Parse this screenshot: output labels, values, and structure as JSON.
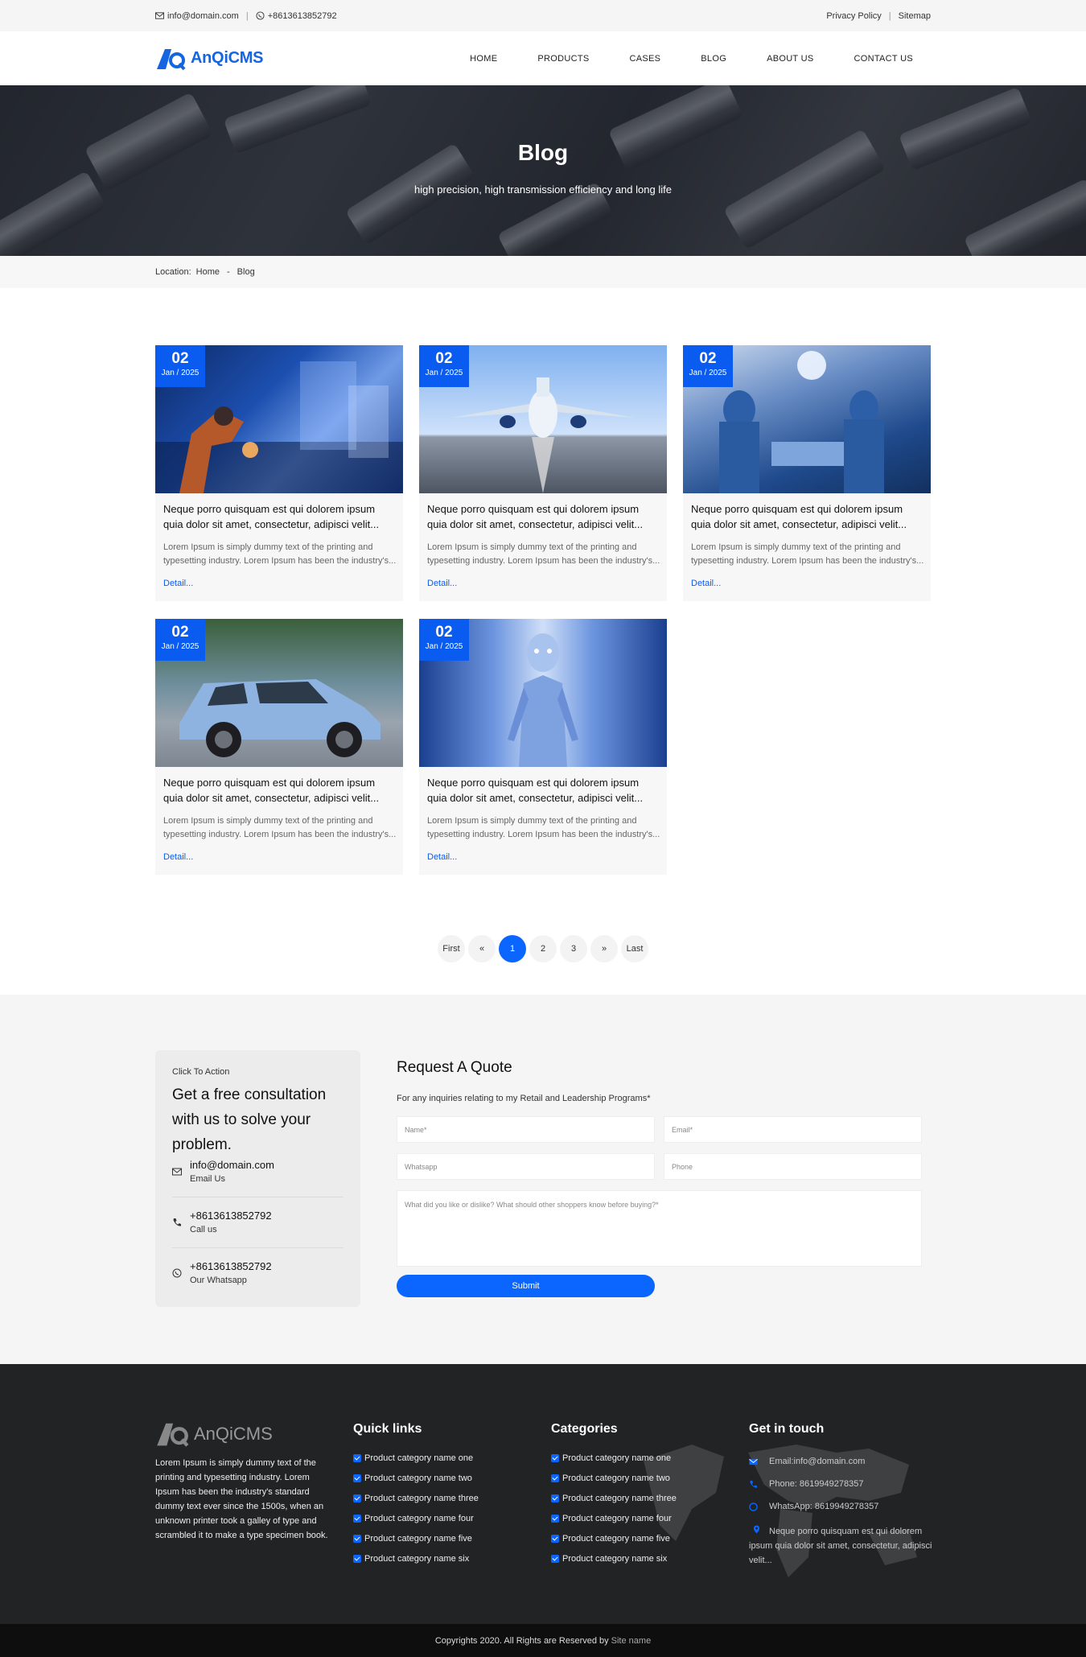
{
  "topbar": {
    "email": "info@domain.com",
    "whatsapp": "+8613613852792",
    "privacy": "Privacy Policy",
    "sitemap": "Sitemap"
  },
  "header": {
    "logo_text": "AnQiCMS",
    "nav": [
      "HOME",
      "PRODUCTS",
      "CASES",
      "BLOG",
      "ABOUT US",
      "CONTACT US"
    ]
  },
  "hero": {
    "title": "Blog",
    "subtitle": "high precision, high transmission efficiency and long life"
  },
  "breadcrumb": {
    "label": "Location:",
    "home": "Home",
    "sep": "-",
    "current": "Blog"
  },
  "posts": [
    {
      "day": "02",
      "month": "Jan / 2025",
      "image": "robot-arm-factory",
      "title": "Neque porro quisquam est qui dolorem ipsum quia dolor sit amet, consectetur, adipisci velit...",
      "excerpt": "Lorem Ipsum is simply dummy text of the printing and typesetting industry. Lorem Ipsum has been the industry's...",
      "more": "Detail..."
    },
    {
      "day": "02",
      "month": "Jan / 2025",
      "image": "airplane-runway",
      "title": "Neque porro quisquam est qui dolorem ipsum quia dolor sit amet, consectetur, adipisci velit...",
      "excerpt": "Lorem Ipsum is simply dummy text of the printing and typesetting industry. Lorem Ipsum has been the industry's...",
      "more": "Detail..."
    },
    {
      "day": "02",
      "month": "Jan / 2025",
      "image": "surgery-room",
      "title": "Neque porro quisquam est qui dolorem ipsum quia dolor sit amet, consectetur, adipisci velit...",
      "excerpt": "Lorem Ipsum is simply dummy text of the printing and typesetting industry. Lorem Ipsum has been the industry's...",
      "more": "Detail..."
    },
    {
      "day": "02",
      "month": "Jan / 2025",
      "image": "blue-suv",
      "title": "Neque porro quisquam est qui dolorem ipsum quia dolor sit amet, consectetur, adipisci velit...",
      "excerpt": "Lorem Ipsum is simply dummy text of the printing and typesetting industry. Lorem Ipsum has been the industry's...",
      "more": "Detail..."
    },
    {
      "day": "02",
      "month": "Jan / 2025",
      "image": "humanoid-robot",
      "title": "Neque porro quisquam est qui dolorem ipsum quia dolor sit amet, consectetur, adipisci velit...",
      "excerpt": "Lorem Ipsum is simply dummy text of the printing and typesetting industry. Lorem Ipsum has been the industry's...",
      "more": "Detail..."
    }
  ],
  "pagination": {
    "first": "First",
    "prev": "«",
    "pages": [
      "1",
      "2",
      "3"
    ],
    "active": "1",
    "next": "»",
    "last": "Last"
  },
  "cta": {
    "kicker": "Click To Action",
    "heading": "Get a free consultation with us to solve your problem.",
    "items": [
      {
        "icon": "mail-icon",
        "value": "info@domain.com",
        "label": "Email Us"
      },
      {
        "icon": "phone-icon",
        "value": "+8613613852792",
        "label": "Call us"
      },
      {
        "icon": "whatsapp-icon",
        "value": "+8613613852792",
        "label": "Our Whatsapp"
      }
    ]
  },
  "quote_form": {
    "title": "Request A Quote",
    "subtitle": "For any inquiries relating to my Retail and Leadership Programs*",
    "name_placeholder": "Name*",
    "email_placeholder": "Email*",
    "whatsapp_placeholder": "Whatsapp",
    "phone_placeholder": "Phone",
    "message_placeholder": "What did you like or dislike? What should other shoppers know before buying?*",
    "submit": "Submit"
  },
  "footer": {
    "logo_text": "AnQiCMS",
    "about": "Lorem Ipsum is simply dummy text of the printing and typesetting industry. Lorem Ipsum has been the industry's standard dummy text ever since the 1500s, when an unknown printer took a galley of type and scrambled it to make a type specimen book.",
    "quick_links": {
      "title": "Quick links",
      "items": [
        "Product category name one",
        "Product category name two",
        "Product category name three",
        "Product category name four",
        "Product category name five",
        "Product category name six"
      ]
    },
    "categories": {
      "title": "Categories",
      "items": [
        "Product category name one",
        "Product category name two",
        "Product category name three",
        "Product category name four",
        "Product category name five",
        "Product category name six"
      ]
    },
    "contact": {
      "title": "Get in touch",
      "email": "Email:info@domain.com",
      "phone": "Phone: 8619949278357",
      "whatsapp": "WhatsApp: 8619949278357",
      "address": "Neque porro quisquam est qui dolorem ipsum quia dolor sit amet, consectetur, adipisci velit..."
    },
    "copyright": "Copyrights 2020. All Rights are Reserved by",
    "site_name": "Site name"
  },
  "colors": {
    "accent": "#0a66ff",
    "date_badge": "#0a5cf0",
    "footer_bg": "#222325"
  }
}
